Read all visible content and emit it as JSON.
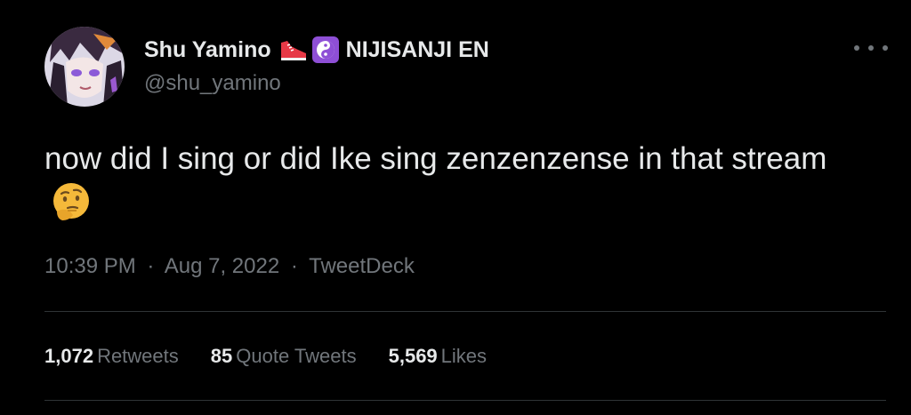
{
  "author": {
    "display_name": "Shu Yamino",
    "handle": "@shu_yamino",
    "affiliation": "NIJISANJI EN",
    "name_emoji_icons": [
      "sneaker-icon",
      "yin-yang-icon"
    ]
  },
  "tweet": {
    "text": "now did I sing or did Ike sing zenzenzense in that stream",
    "trailing_emoji_icon": "thinking-face-icon",
    "time": "10:39 PM",
    "date": "Aug 7, 2022",
    "separator": "·",
    "source": "TweetDeck"
  },
  "stats": {
    "retweets_count": "1,072",
    "retweets_label": "Retweets",
    "quotes_count": "85",
    "quotes_label": "Quote Tweets",
    "likes_count": "5,569",
    "likes_label": "Likes"
  },
  "menu_icon": "more-horizontal-icon",
  "colors": {
    "background": "#000000",
    "primary_text": "#e7e9ea",
    "secondary_text": "#71767b",
    "divider": "#2f3336",
    "yin_yang_badge": "#8e4fd6",
    "shoe_red": "#e63946"
  }
}
